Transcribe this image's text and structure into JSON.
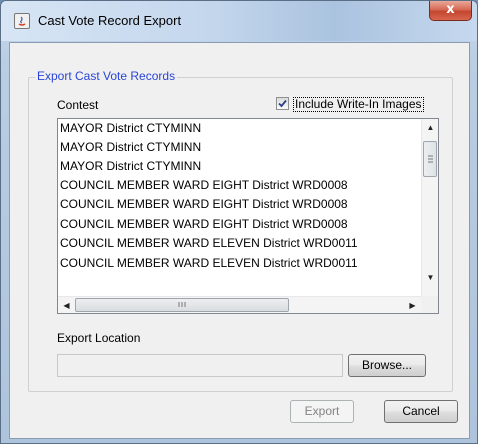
{
  "window": {
    "title": "Cast Vote Record Export",
    "close_label": "x"
  },
  "group": {
    "label": "Export Cast Vote Records"
  },
  "contest": {
    "label": "Contest",
    "include_write_in": {
      "label": "Include Write-In Images",
      "checked": true
    },
    "items": [
      "MAYOR District CTYMINN",
      "MAYOR District CTYMINN",
      "MAYOR District CTYMINN",
      "COUNCIL MEMBER WARD EIGHT District WRD0008",
      "COUNCIL MEMBER WARD EIGHT District WRD0008",
      "COUNCIL MEMBER WARD EIGHT District WRD0008",
      "COUNCIL MEMBER WARD ELEVEN District WRD0011",
      "COUNCIL MEMBER WARD ELEVEN District WRD0011"
    ]
  },
  "export_location": {
    "label": "Export Location",
    "value": "",
    "browse_label": "Browse..."
  },
  "footer": {
    "export_label": "Export",
    "cancel_label": "Cancel"
  }
}
